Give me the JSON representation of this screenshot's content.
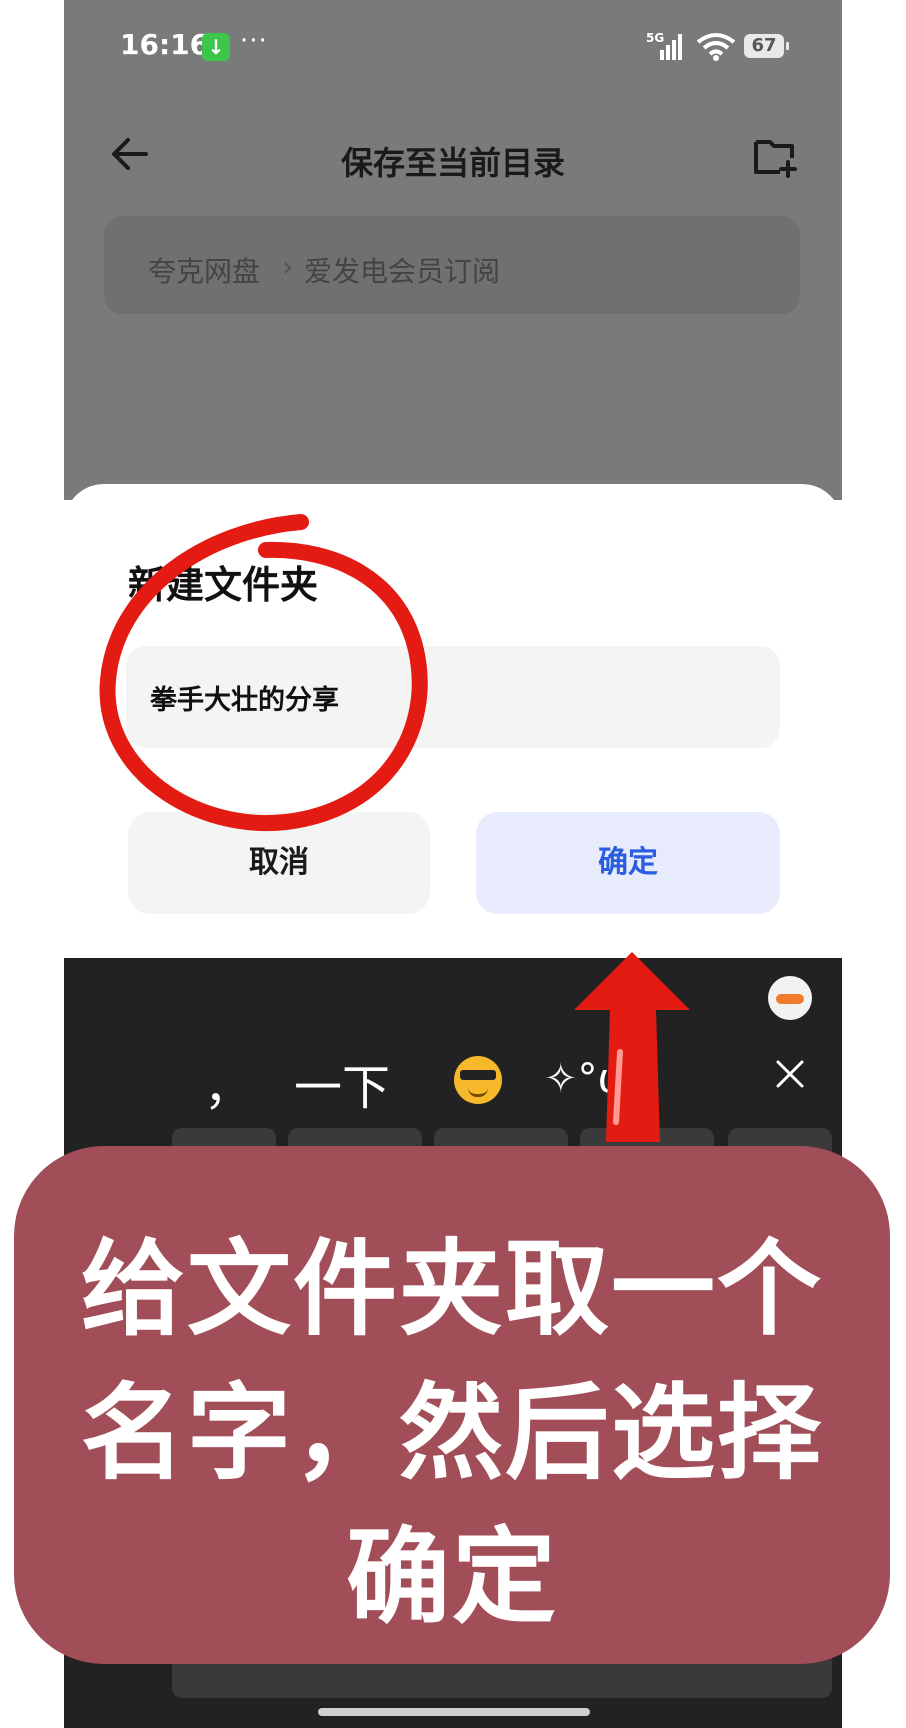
{
  "status_bar": {
    "time": "16:16",
    "network": "5G",
    "battery": "67",
    "more": "···"
  },
  "header": {
    "title": "保存至当前目录"
  },
  "breadcrumb": {
    "items": [
      "夸克网盘",
      "爱发电会员订阅"
    ],
    "separator": "›"
  },
  "dialog": {
    "title": "新建文件夹",
    "input_value": "拳手大壮的分享",
    "cancel_label": "取消",
    "confirm_label": "确定"
  },
  "keyboard": {
    "candidates": [
      "，",
      "一下",
      "✧°ω`"
    ]
  },
  "caption": {
    "line1": "给文件夹取一个",
    "line2": "名字，然后选择",
    "line3": "确定"
  },
  "colors": {
    "accent": "#2b5de0",
    "annotation_red": "#e31b12",
    "caption_bg": "#a14e59"
  }
}
